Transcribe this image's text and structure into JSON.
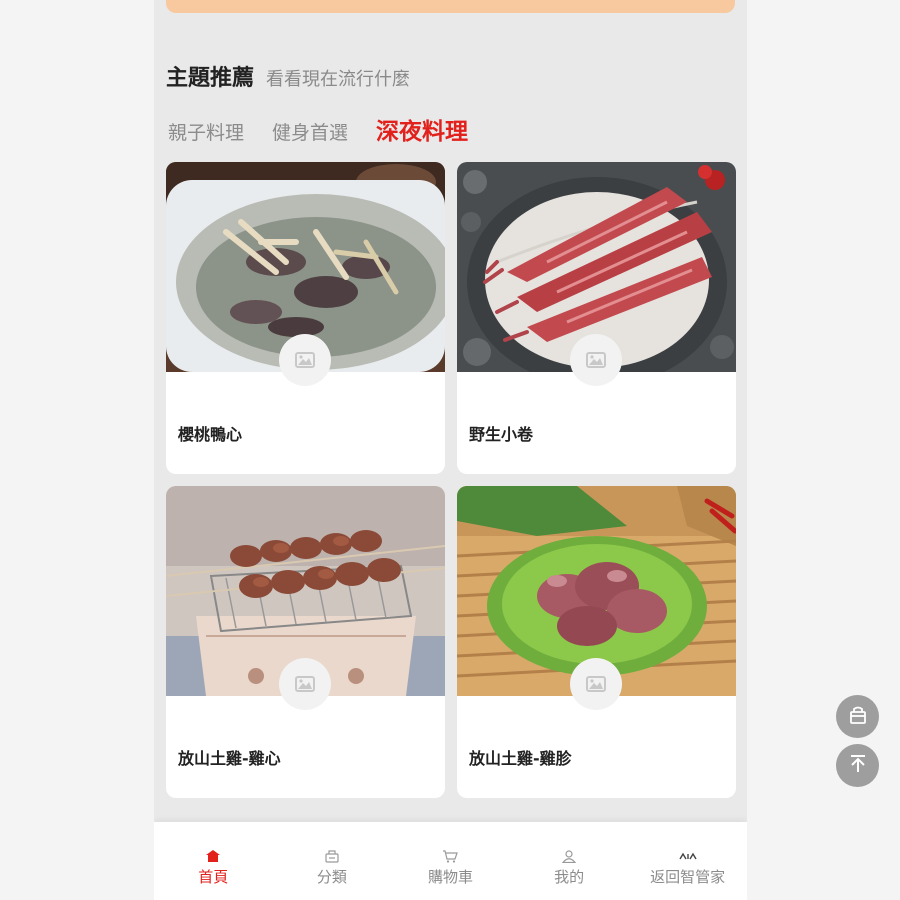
{
  "section": {
    "title": "主題推薦",
    "subtitle": "看看現在流行什麼"
  },
  "tabs": [
    {
      "label": "親子料理",
      "active": false
    },
    {
      "label": "健身首選",
      "active": false
    },
    {
      "label": "深夜料理",
      "active": true
    }
  ],
  "products": [
    {
      "name": "櫻桃鴨心",
      "image": "duck-heart-soup-photo"
    },
    {
      "name": "野生小卷",
      "image": "raw-squid-photo"
    },
    {
      "name": "放山土雞-雞心",
      "image": "grilled-chicken-heart-skewers-photo"
    },
    {
      "name": "放山土雞-雞胗",
      "image": "chicken-gizzard-on-lettuce-photo"
    }
  ],
  "bottom_nav": [
    {
      "label": "首頁",
      "icon": "home-icon",
      "active": true
    },
    {
      "label": "分類",
      "icon": "category-icon",
      "active": false
    },
    {
      "label": "購物車",
      "icon": "cart-icon",
      "active": false
    },
    {
      "label": "我的",
      "icon": "user-icon",
      "active": false
    },
    {
      "label": "返回智管家",
      "icon": "brand-icon",
      "active": false
    }
  ],
  "floating_buttons": [
    {
      "icon": "shopping-bag-icon"
    },
    {
      "icon": "back-to-top-icon"
    }
  ],
  "colors": {
    "accent": "#e2211c",
    "banner": "#f8c99e",
    "background": "#e9e9e9"
  }
}
